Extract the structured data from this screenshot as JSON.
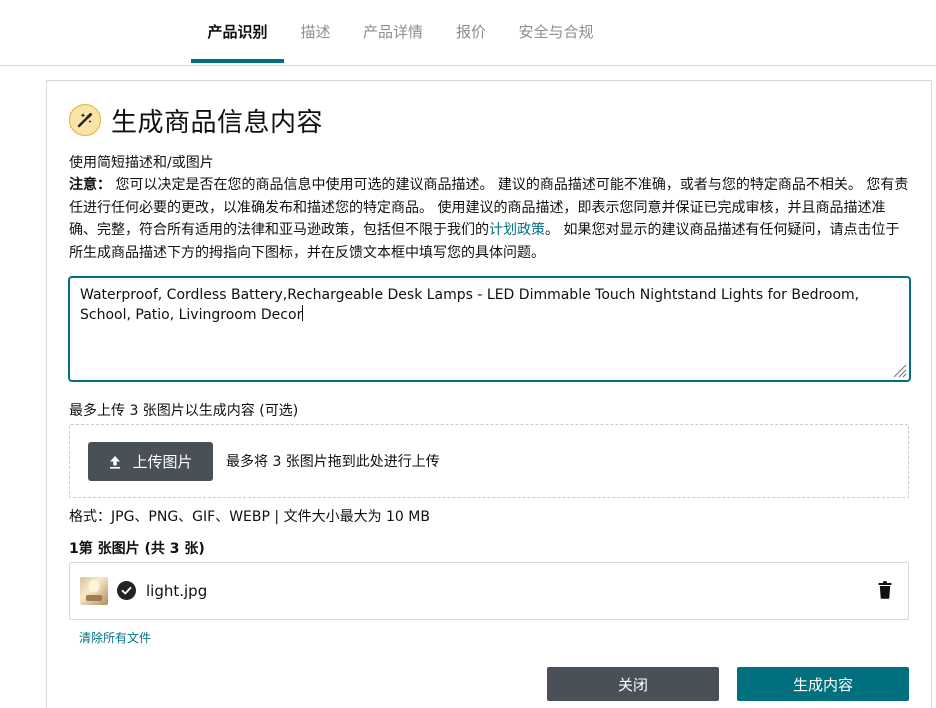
{
  "tabs": [
    {
      "label": "产品识别",
      "active": true
    },
    {
      "label": "描述",
      "active": false
    },
    {
      "label": "产品详情",
      "active": false
    },
    {
      "label": "报价",
      "active": false
    },
    {
      "label": "安全与合规",
      "active": false
    }
  ],
  "header": {
    "icon": "magic-wand-icon",
    "title": "生成商品信息内容"
  },
  "subtitle": "使用简短描述和/或图片",
  "note": {
    "label": "注意：",
    "text_part1": " 您可以决定是否在您的商品信息中使用可选的建议商品描述。 建议的商品描述可能不准确，或者与您的特定商品不相关。 您有责任进行任何必要的更改，以准确发布和描述您的特定商品。 使用建议的商品描述，即表示您同意并保证已完成审核，并且商品描述准确、完整，符合所有适用的法律和亚马逊政策，包括但不限于我们的",
    "link": "计划政策",
    "text_part2": "。 如果您对显示的建议商品描述有任何疑问，请点击位于所生成商品描述下方的拇指向下图标，并在反馈文本框中填写您的具体问题。"
  },
  "description_input": {
    "value": "Waterproof, Cordless Battery,Rechargeable Desk Lamps - LED Dimmable Touch Nightstand Lights for Bedroom, School, Patio, Livingroom Decor"
  },
  "upload": {
    "label": "最多上传 3 张图片以生成内容 (可选)",
    "button_label": "上传图片",
    "drop_hint": "最多将 3 张图片拖到此处进行上传",
    "formats": "格式：JPG、PNG、GIF、WEBP | 文件大小最大为 10 MB",
    "count": "1第 张图片 (共 3 张)"
  },
  "files": [
    {
      "name": "light.jpg",
      "status": "uploaded"
    }
  ],
  "clear_all": "清除所有文件",
  "actions": {
    "close": "关闭",
    "generate": "生成内容"
  },
  "colors": {
    "accent": "#00707e",
    "link": "#007185",
    "dark_button": "#4a5058"
  }
}
